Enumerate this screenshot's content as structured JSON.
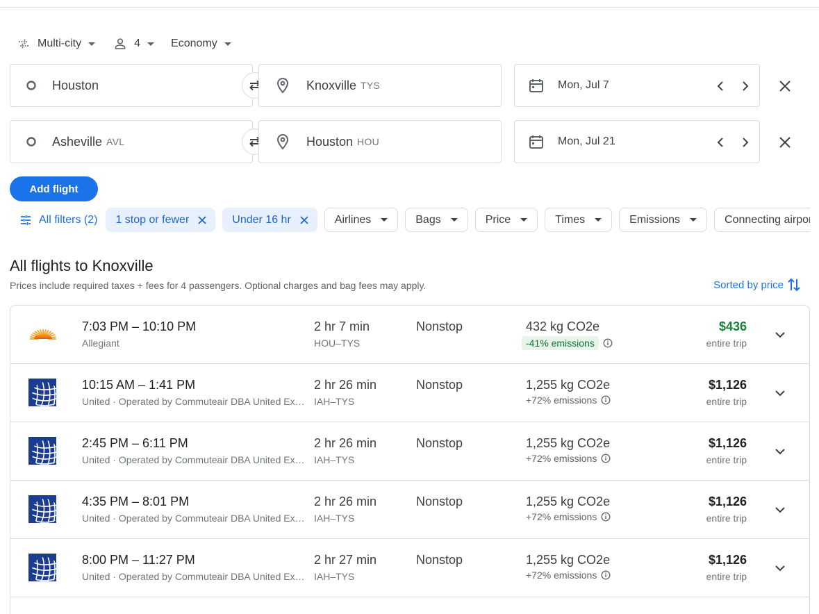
{
  "search": {
    "trip_type": "Multi-city",
    "passengers": "4",
    "cabin": "Economy",
    "legs": [
      {
        "origin": "Houston",
        "origin_code": "",
        "destination": "Knoxville",
        "destination_code": "TYS",
        "date": "Mon, Jul 7"
      },
      {
        "origin": "Asheville",
        "origin_code": "AVL",
        "destination": "Houston",
        "destination_code": "HOU",
        "date": "Mon, Jul 21"
      }
    ],
    "add_flight_label": "Add flight"
  },
  "filters": {
    "all_label": "All filters (2)",
    "active": [
      "1 stop or fewer",
      "Under 16 hr"
    ],
    "dropdowns": [
      "Airlines",
      "Bags",
      "Price",
      "Times",
      "Emissions",
      "Connecting airports"
    ]
  },
  "results": {
    "title": "All flights to Knoxville",
    "subtitle": "Prices include required taxes + fees for 4 passengers. Optional charges and bag fees may apply.",
    "sort_label": "Sorted by price",
    "flights": [
      {
        "times": "7:03 PM – 10:10 PM",
        "airline": "Allegiant",
        "duration": "2 hr 7 min",
        "route": "HOU–TYS",
        "stops": "Nonstop",
        "co2": "432 kg CO2e",
        "emissions": "-41% emissions",
        "price": "$436",
        "price_type": "entire trip",
        "logo": "allegiant-sun-logo"
      },
      {
        "times": "10:15 AM – 1:41 PM",
        "airline": "United · Operated by Commuteair DBA United Express",
        "duration": "2 hr 26 min",
        "route": "IAH–TYS",
        "stops": "Nonstop",
        "co2": "1,255 kg CO2e",
        "emissions": "+72% emissions",
        "price": "$1,126",
        "price_type": "entire trip",
        "logo": "united-globe-logo"
      },
      {
        "times": "2:45 PM – 6:11 PM",
        "airline": "United · Operated by Commuteair DBA United Express",
        "duration": "2 hr 26 min",
        "route": "IAH–TYS",
        "stops": "Nonstop",
        "co2": "1,255 kg CO2e",
        "emissions": "+72% emissions",
        "price": "$1,126",
        "price_type": "entire trip",
        "logo": "united-globe-logo"
      },
      {
        "times": "4:35 PM – 8:01 PM",
        "airline": "United · Operated by Commuteair DBA United Express",
        "duration": "2 hr 26 min",
        "route": "IAH–TYS",
        "stops": "Nonstop",
        "co2": "1,255 kg CO2e",
        "emissions": "+72% emissions",
        "price": "$1,126",
        "price_type": "entire trip",
        "logo": "united-globe-logo"
      },
      {
        "times": "8:00 PM – 11:27 PM",
        "airline": "United · Operated by Commuteair DBA United Express",
        "duration": "2 hr 27 min",
        "route": "IAH–TYS",
        "stops": "Nonstop",
        "co2": "1,255 kg CO2e",
        "emissions": "+72% emissions",
        "price": "$1,126",
        "price_type": "entire trip",
        "logo": "united-globe-logo"
      }
    ]
  },
  "colors": {
    "accent": "#1a73e8",
    "good_price": "#188038",
    "good_emissions_bg": "#e6f4ea",
    "chip_active_bg": "#e8f0fe"
  }
}
